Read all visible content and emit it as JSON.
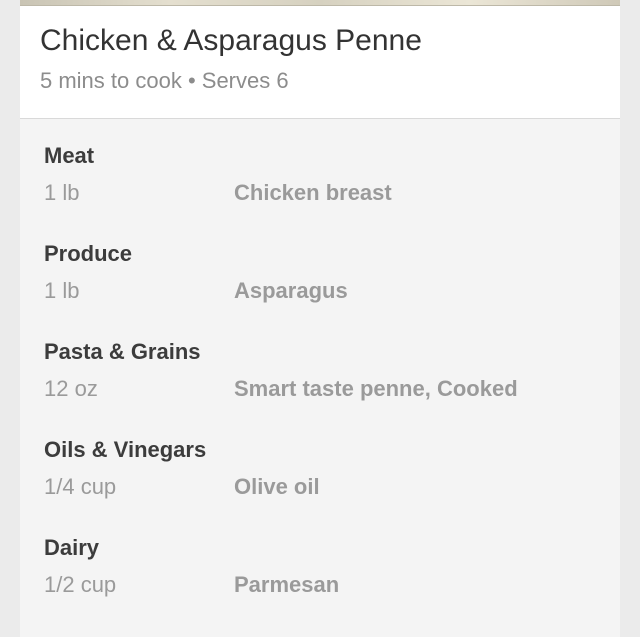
{
  "recipe": {
    "title": "Chicken & Asparagus Penne",
    "subtitle": "5 mins to cook • Serves 6"
  },
  "ingredient_groups": [
    {
      "category": "Meat",
      "items": [
        {
          "quantity": "1 lb",
          "name": "Chicken breast"
        }
      ]
    },
    {
      "category": "Produce",
      "items": [
        {
          "quantity": "1 lb",
          "name": "Asparagus"
        }
      ]
    },
    {
      "category": "Pasta & Grains",
      "items": [
        {
          "quantity": "12 oz",
          "name": "Smart taste penne, Cooked"
        }
      ]
    },
    {
      "category": "Oils & Vinegars",
      "items": [
        {
          "quantity": "1/4 cup",
          "name": "Olive oil"
        }
      ]
    },
    {
      "category": "Dairy",
      "items": [
        {
          "quantity": "1/2 cup",
          "name": "Parmesan"
        }
      ]
    }
  ],
  "colors": {
    "page_background": "#ebebeb",
    "card_background": "#f4f4f4",
    "header_background": "#ffffff",
    "title_text": "#333333",
    "muted_text": "#9a9a9a"
  }
}
